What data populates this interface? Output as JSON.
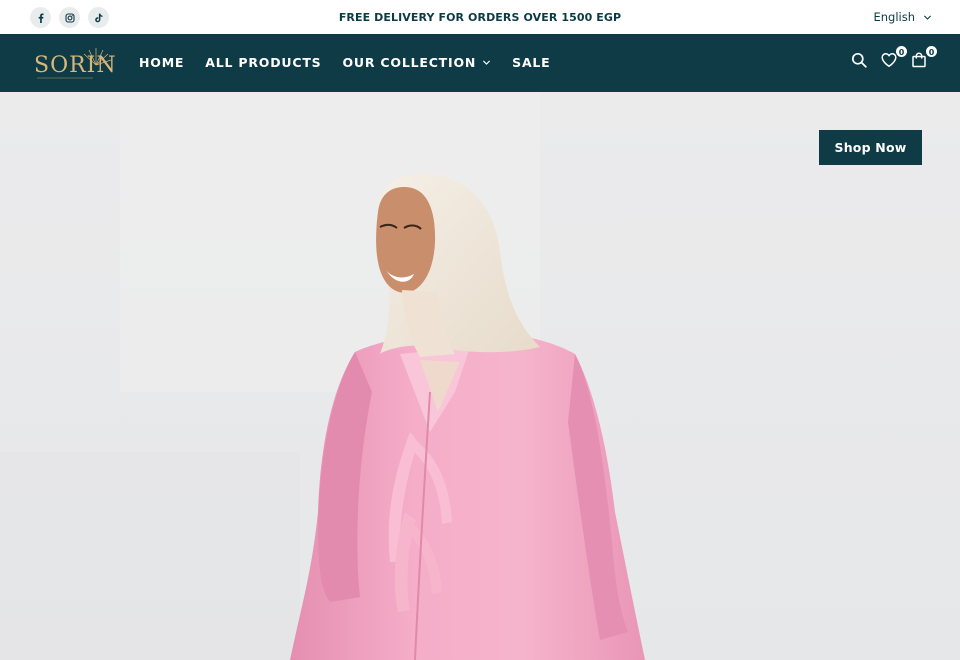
{
  "announcement": "FREE DELIVERY FOR ORDERS OVER 1500 EGP",
  "social": [
    {
      "name": "facebook-icon",
      "glyph": "f"
    },
    {
      "name": "instagram-icon",
      "glyph": "instagram"
    },
    {
      "name": "tiktok-icon",
      "glyph": "tiktok"
    }
  ],
  "language": {
    "selected": "English"
  },
  "brand": {
    "logo_text": "SORIN"
  },
  "nav": {
    "items": [
      {
        "label": "HOME"
      },
      {
        "label": "ALL PRODUCTS"
      },
      {
        "label": "OUR COLLECTION",
        "has_dropdown": true
      },
      {
        "label": "SALE"
      }
    ]
  },
  "header_icons": {
    "wishlist_count": "0",
    "cart_count": "0"
  },
  "hero": {
    "cta_label": "Shop Now"
  },
  "colors": {
    "primary": "#0e3b45",
    "logo_gold": "#d8b77a",
    "hero_bg": "#ededee",
    "dress_pink": "#f4a8c4",
    "hijab_cream": "#efe6da"
  }
}
